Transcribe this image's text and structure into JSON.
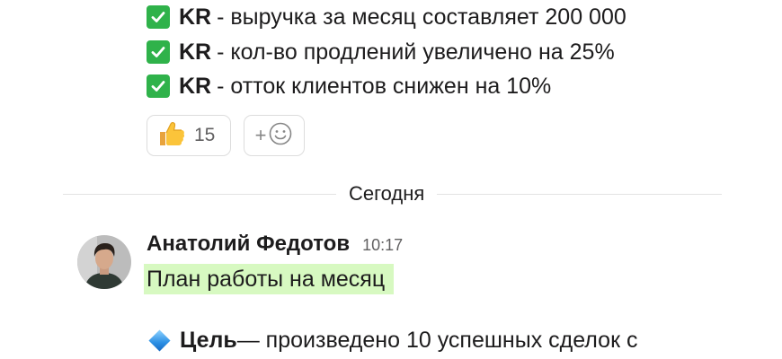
{
  "kr_items": [
    {
      "label": "KR",
      "text": " - выручка за месяц составляет 200 000"
    },
    {
      "label": "KR",
      "text": " - кол-во продлений увеличено на 25%"
    },
    {
      "label": "KR",
      "text": " - отток клиентов снижен на 10%"
    }
  ],
  "reactions": {
    "thumbs_count": "15",
    "add_symbol": "+"
  },
  "divider": {
    "label": "Сегодня"
  },
  "message": {
    "author": "Анатолий Федотов",
    "time": "10:17",
    "highlighted_text": "План работы на месяц",
    "goal_label": "Цель",
    "goal_text": " — произведено 10 успешных сделок с"
  },
  "colors": {
    "check_green": "#2fb24a",
    "highlight_bg": "#d7f9c1",
    "muted_text": "#616061"
  }
}
